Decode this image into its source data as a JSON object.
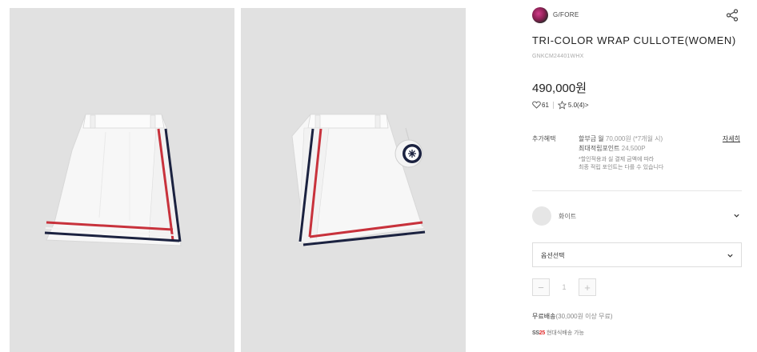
{
  "brand": {
    "name": "G/FORE",
    "logo_icon": "brand-logo",
    "share_icon": "share-icon"
  },
  "product": {
    "title": "TRI-COLOR WRAP CULLOTE(WOMEN)",
    "code": "GNKCM24401WHX",
    "price": "490,000원",
    "likes": "61",
    "rating": "5.0",
    "reviews": "(4)",
    "reviews_arrow": ">"
  },
  "benefits": {
    "label": "추가혜택",
    "installment_prefix": "할부금 월 ",
    "installment_amount": "70,000원",
    "installment_suffix": " (*7개월 시)",
    "points_prefix": "최대적립포인트 ",
    "points_amount": "24,500P",
    "note_line1": "*할인적용과 실 결제 금액에 따라",
    "note_line2": "최종 적립 포인트는 다를 수 있습니다",
    "detail_link": "자세히"
  },
  "color_option": {
    "value": "화이트",
    "swatch_color": "#e6e6e6"
  },
  "option_select": {
    "label": "옵션선택"
  },
  "quantity": {
    "minus": "−",
    "value": "1",
    "plus": "+"
  },
  "shipping": {
    "main": "무료배송",
    "detail": "(30,000원 이상 무료)"
  },
  "delivery": {
    "badge_prefix": "SS",
    "badge_num": "25",
    "text": "현대식배송 가능"
  },
  "colors": {
    "stripe_red": "#c8323c",
    "stripe_navy": "#1b2240",
    "photo_bg": "#e1e1e1"
  }
}
